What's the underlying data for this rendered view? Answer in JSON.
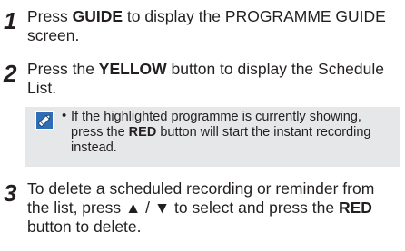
{
  "steps": [
    {
      "number": "1",
      "parts": [
        "Press ",
        "GUIDE",
        " to display the PROGRAMME GUIDE screen."
      ]
    },
    {
      "number": "2",
      "parts": [
        "Press the ",
        "YELLOW",
        " button to display the Schedule List."
      ]
    },
    {
      "number": "3",
      "parts": [
        "To delete a scheduled recording or reminder from the list, press ▲ / ▼ to select and press the ",
        "RED",
        " button to delete."
      ]
    }
  ],
  "note": {
    "icon": "note-pencil-icon",
    "bullet": "•",
    "parts": [
      "If the highlighted programme is currently showing, press the ",
      "RED",
      " button will start the instant recording instead."
    ]
  },
  "colors": {
    "text": "#231f20",
    "note_background": "#e6e7e8",
    "icon_background": "#2f6db5"
  }
}
